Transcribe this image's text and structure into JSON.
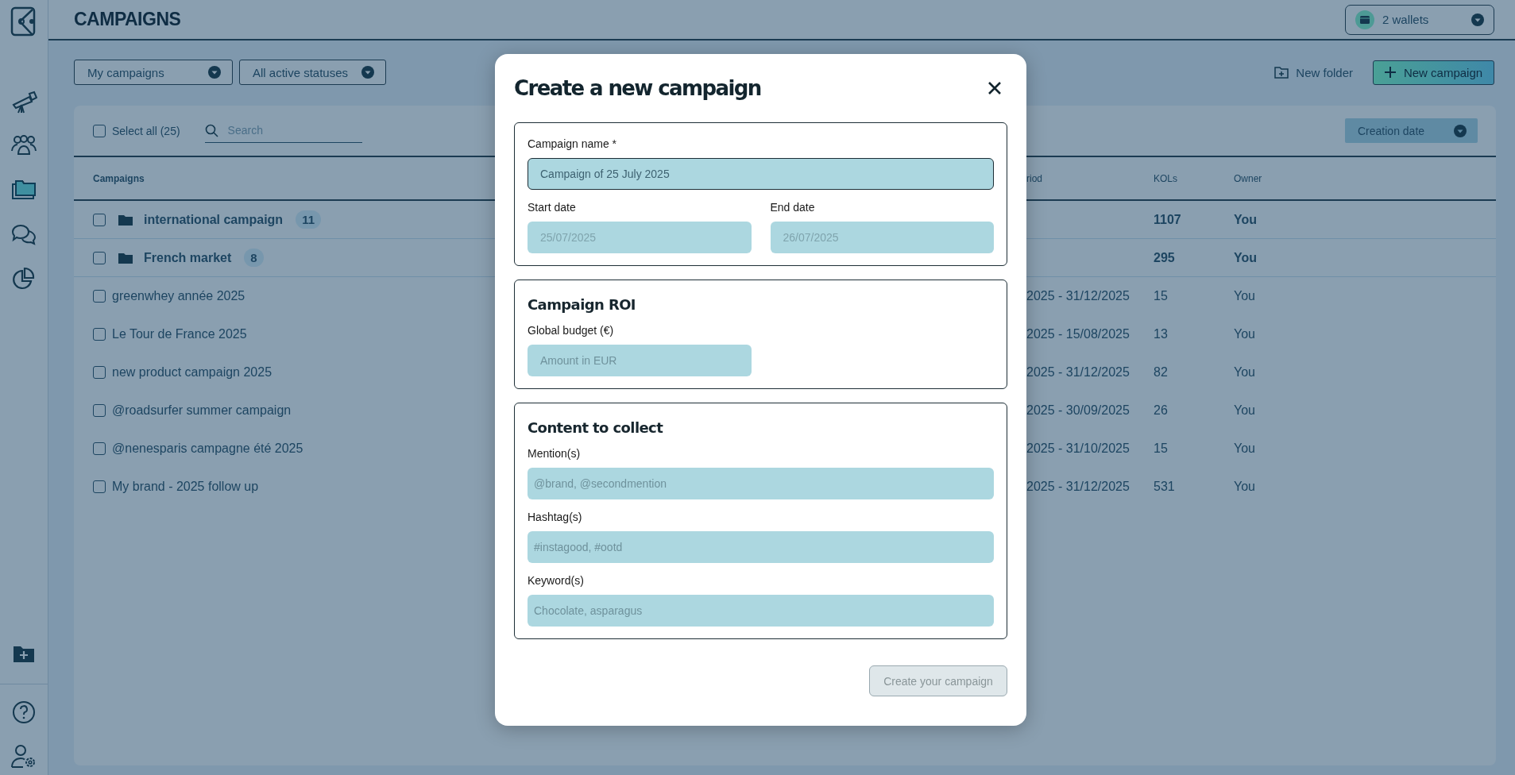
{
  "sidebar": {
    "items": [
      {
        "selected": false
      },
      {
        "selected": false
      },
      {
        "selected": true
      },
      {
        "selected": false
      },
      {
        "selected": false
      }
    ]
  },
  "header": {
    "title": "CAMPAIGNS",
    "wallets": "2 wallets"
  },
  "filters": [
    "My campaigns",
    "All active statuses"
  ],
  "actions": {
    "new_folder": "New folder",
    "new_campaign": "New campaign"
  },
  "table": {
    "select_all": {
      "label": "Select all (25)",
      "checked": false
    },
    "search": {
      "placeholder": "Search"
    },
    "sort": "Creation date",
    "columns": [
      "Campaigns",
      "riod",
      "KOLs",
      "Owner"
    ],
    "rows": [
      {
        "kind": "folder",
        "name": "international campaign",
        "count": "11",
        "kols": "1107",
        "owner": "You",
        "checked": false
      },
      {
        "kind": "folder",
        "name": "French market",
        "count": "8",
        "kols": "295",
        "owner": "You",
        "checked": false
      },
      {
        "kind": "campaign",
        "name": "greenwhey année 2025",
        "period": "2025 - 31/12/2025",
        "kols": "15",
        "owner": "You",
        "checked": false
      },
      {
        "kind": "campaign",
        "name": "Le Tour de France 2025",
        "period": "2025 - 15/08/2025",
        "kols": "13",
        "owner": "You",
        "checked": false
      },
      {
        "kind": "campaign",
        "name": "new product campaign 2025",
        "period": "2025 - 31/12/2025",
        "kols": "82",
        "owner": "You",
        "checked": false
      },
      {
        "kind": "campaign",
        "name": "@roadsurfer summer campaign",
        "period": "2025 - 30/09/2025",
        "kols": "26",
        "owner": "You",
        "checked": false
      },
      {
        "kind": "campaign",
        "name": "@nenesparis campagne été 2025",
        "period": "2025 - 31/10/2025",
        "kols": "15",
        "owner": "You",
        "checked": false
      },
      {
        "kind": "campaign",
        "name": "My brand - 2025 follow up",
        "period": "2025 - 31/12/2025",
        "kols": "531",
        "owner": "You",
        "checked": false
      }
    ]
  },
  "modal": {
    "title": "Create a new campaign",
    "sections": [
      {
        "fields": [
          {
            "kind": "text",
            "label": "Campaign name *",
            "value": "Campaign of 25 July 2025",
            "focused": true
          },
          {
            "kind": "date",
            "label": "Start date",
            "placeholder": "25/07/2025",
            "focused": false
          },
          {
            "kind": "date",
            "label": "End date",
            "placeholder": "26/07/2025",
            "focused": false
          }
        ]
      },
      {
        "heading": "Campaign ROI",
        "fields": [
          {
            "kind": "amount",
            "label": "Global budget (€)",
            "placeholder": "Amount in EUR",
            "focused": false
          }
        ]
      },
      {
        "heading": "Content to collect",
        "fields": [
          {
            "kind": "text",
            "label": "Mention(s)",
            "placeholder": "@brand, @secondmention",
            "focused": false
          },
          {
            "kind": "text",
            "label": "Hashtag(s)",
            "placeholder": "#instagood, #ootd",
            "focused": false
          },
          {
            "kind": "text",
            "label": "Keyword(s)",
            "placeholder": "Chocolate, asparagus",
            "focused": false
          }
        ]
      }
    ],
    "submit": {
      "label": "Create your campaign",
      "disabled": true
    }
  }
}
